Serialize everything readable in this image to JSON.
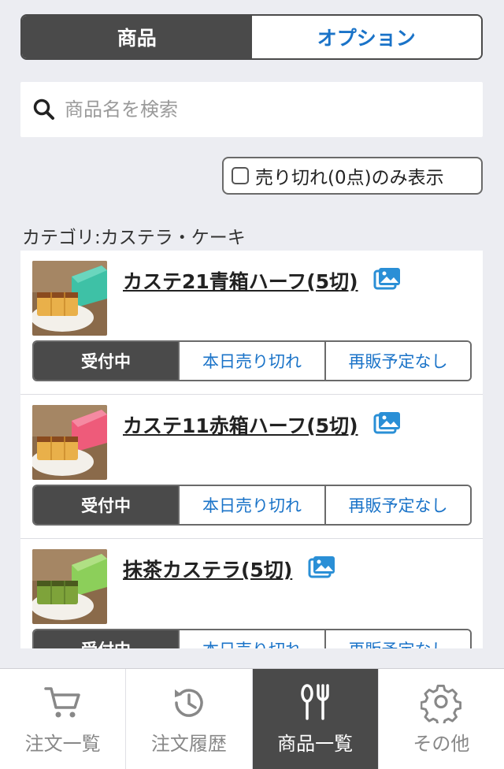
{
  "segment": {
    "products_label": "商品",
    "options_label": "オプション"
  },
  "search": {
    "placeholder": "商品名を検索"
  },
  "filter": {
    "soldout_label": "売り切れ(0点)のみ表示"
  },
  "category": {
    "label": "カテゴリ:カステラ・ケーキ"
  },
  "items": [
    {
      "name": "カステ21青箱ハーフ(5切)",
      "box_color": "#3ec1a6",
      "cake_color": "#e9b04a",
      "status_accepting": "受付中",
      "status_soldout_today": "本日売り切れ",
      "status_no_resale": "再販予定なし"
    },
    {
      "name": "カステ11赤箱ハーフ(5切)",
      "box_color": "#ee5b7a",
      "cake_color": "#e9b04a",
      "status_accepting": "受付中",
      "status_soldout_today": "本日売り切れ",
      "status_no_resale": "再販予定なし"
    },
    {
      "name": "抹茶カステラ(5切)",
      "box_color": "#8ccf5a",
      "cake_color": "#7ea33a",
      "status_accepting": "受付中",
      "status_soldout_today": "本日売り切れ",
      "status_no_resale": "再販予定なし"
    }
  ],
  "tabbar": {
    "orders": "注文一覧",
    "history": "注文履歴",
    "products": "商品一覧",
    "other": "その他"
  },
  "colors": {
    "accent_blue": "#1a73c8",
    "dark": "#4a4a4a",
    "background": "#ecedf2"
  }
}
